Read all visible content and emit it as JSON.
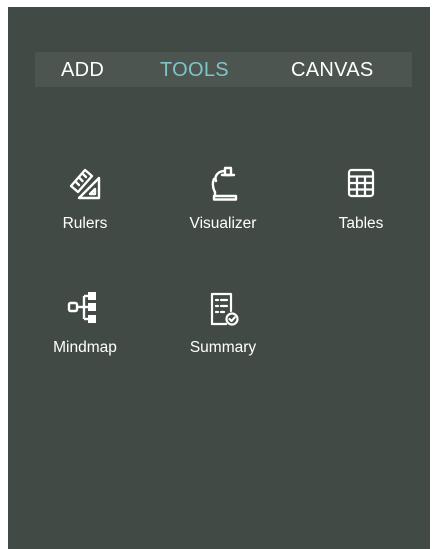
{
  "colors": {
    "panel_bg": "#414a45",
    "tabbar_bg": "#4c5550",
    "text": "#ffffff",
    "active_tab": "#7fc4c9"
  },
  "tabs": [
    {
      "label": "ADD",
      "active": false
    },
    {
      "label": "TOOLS",
      "active": true
    },
    {
      "label": "CANVAS",
      "active": false
    }
  ],
  "tools": [
    {
      "label": "Rulers",
      "icon": "ruler-icon"
    },
    {
      "label": "Visualizer",
      "icon": "desk-lamp-icon"
    },
    {
      "label": "Tables",
      "icon": "table-icon"
    },
    {
      "label": "Mindmap",
      "icon": "mindmap-icon"
    },
    {
      "label": "Summary",
      "icon": "summary-document-icon"
    }
  ]
}
